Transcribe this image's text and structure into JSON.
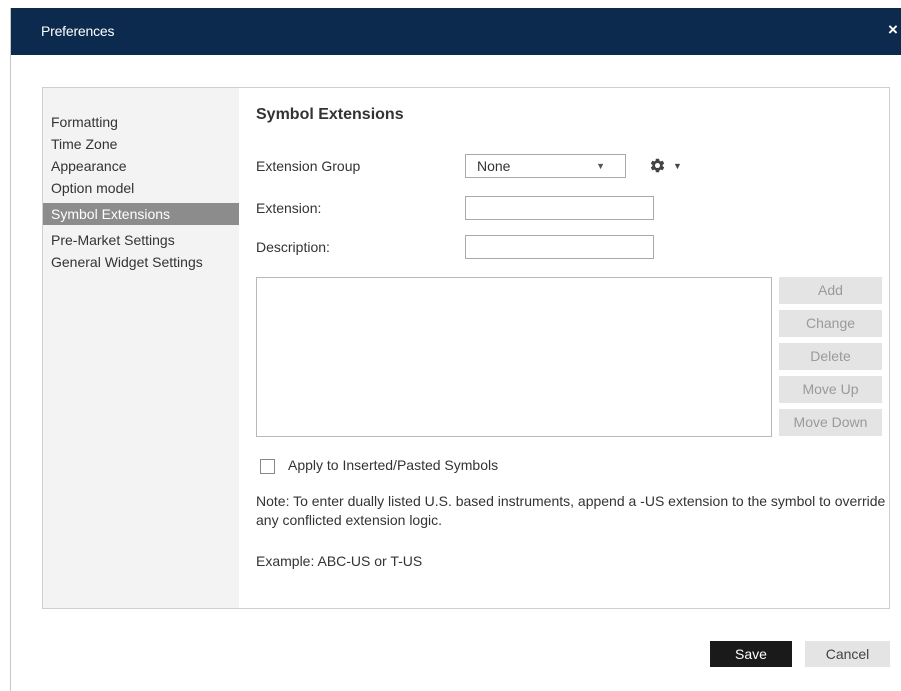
{
  "dialog": {
    "title": "Preferences",
    "close_label": "×"
  },
  "nav": {
    "items": [
      {
        "label": "Formatting"
      },
      {
        "label": "Time Zone"
      },
      {
        "label": "Appearance"
      },
      {
        "label": "Option model"
      },
      {
        "label": "Symbol Extensions",
        "selected": true
      },
      {
        "label": "Pre-Market Settings"
      },
      {
        "label": "General Widget Settings"
      }
    ]
  },
  "content": {
    "title": "Symbol Extensions",
    "extension_group_label": "Extension Group",
    "extension_group_value": "None",
    "extension_label": "Extension:",
    "extension_value": "",
    "description_label": "Description:",
    "description_value": "",
    "buttons": {
      "add": "Add",
      "change": "Change",
      "delete": "Delete",
      "move_up": "Move Up",
      "move_down": "Move Down"
    },
    "apply_checkbox_label": "Apply to Inserted/Pasted Symbols",
    "apply_checked": false,
    "note": "Note: To enter dually listed U.S. based instruments, append a -US extension to the symbol to override any conflicted extension logic.",
    "example": "Example: ABC-US or T-US"
  },
  "footer": {
    "save_label": "Save",
    "cancel_label": "Cancel"
  },
  "icons": {
    "dropdown": "chevron-down-icon",
    "settings": "gear-icon",
    "close": "close-icon"
  },
  "colors": {
    "titlebar": "#0c2a4e",
    "nav_selected": "#8c8c8c",
    "save_button": "#1a1a1a",
    "disabled_button": "#e4e4e4"
  }
}
